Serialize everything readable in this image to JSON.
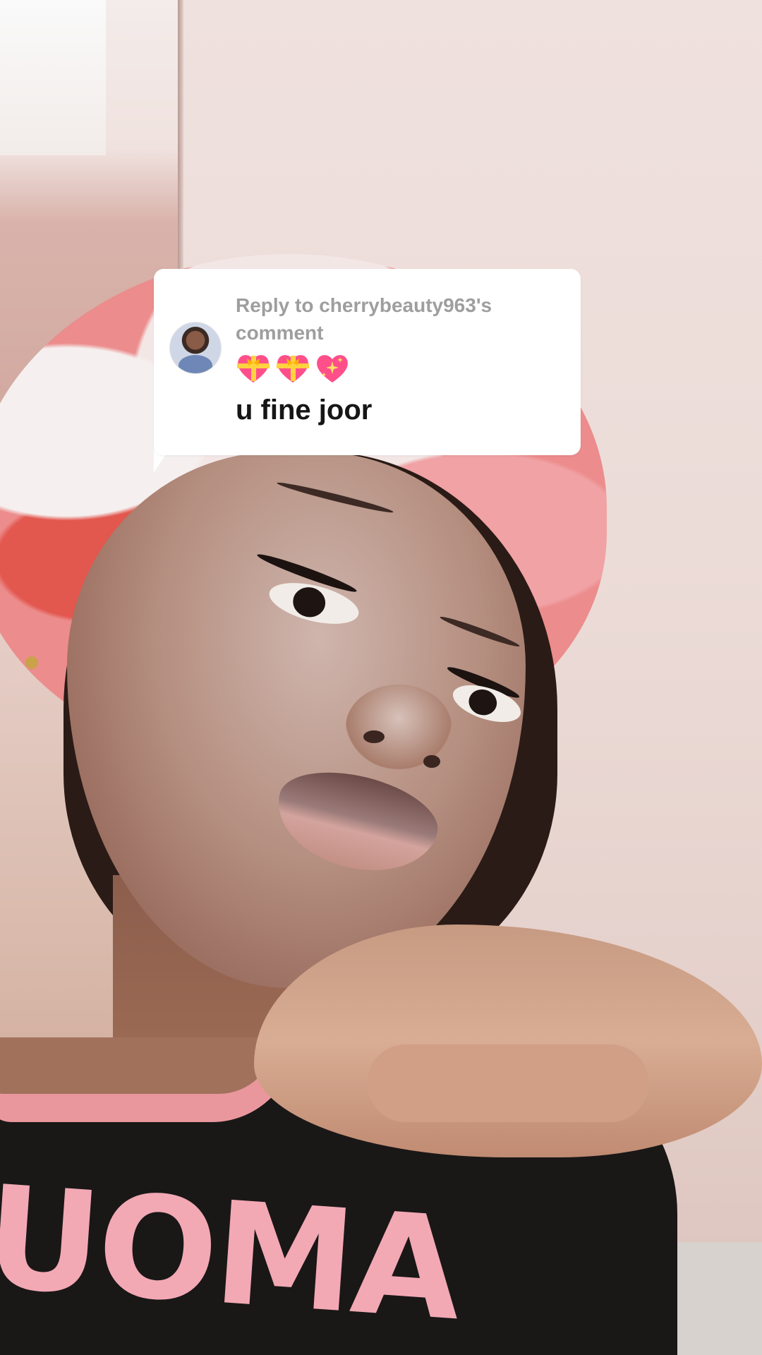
{
  "reply_card": {
    "label": "Reply to cherrybeauty963's comment",
    "emoji_icons": [
      "heart-with-ribbon",
      "heart-with-ribbon",
      "sparkling-heart"
    ],
    "comment": "u fine joor"
  },
  "shirt_print": "UOMA",
  "colors": {
    "card_background": "#ffffff",
    "label_gray": "#9e9e9e",
    "comment_text": "#161616",
    "heart_pink": "#ff4f8b"
  }
}
